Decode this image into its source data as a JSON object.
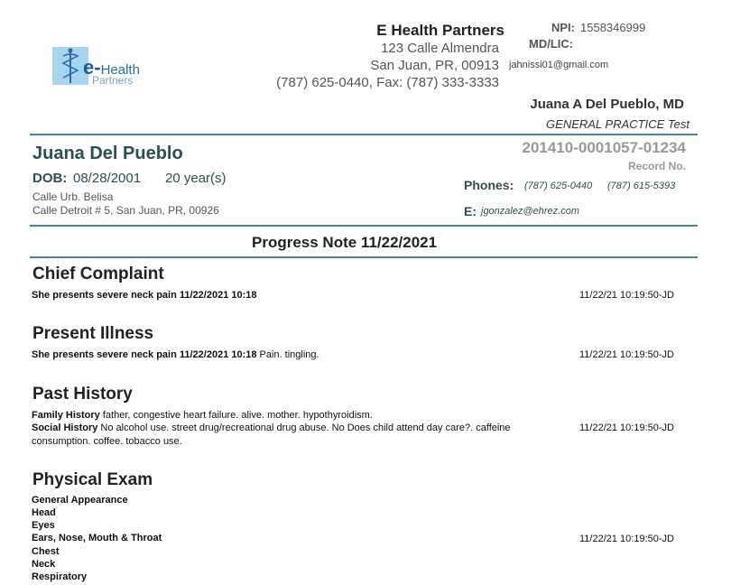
{
  "practice": {
    "logo_text_main": "e-",
    "logo_text_health": "Health",
    "logo_text_partners": "Partners",
    "name": "E Health Partners",
    "address1": "123 Calle Almendra",
    "address2": "San Juan, PR, 00913",
    "phone_fax": "(787) 625-0440, Fax: (787) 333-3333",
    "npi_label": "NPI:",
    "npi_value": "1558346999",
    "mdlic_label": "MD/LIC:",
    "email": "jahnissi01@gmail.com",
    "doctor_name": "Juana A Del Pueblo, MD",
    "doctor_specialty": "GENERAL PRACTICE Test"
  },
  "patient": {
    "name": "Juana Del Pueblo",
    "dob_label": "DOB:",
    "dob": "08/28/2001",
    "age": "20 year(s)",
    "address1": "Calle Urb. Belisa",
    "address2": "Calle Detroit # 5, San Juan, PR, 00926",
    "record_number": "201410-0001057-01234",
    "record_label": "Record No.",
    "phones_label": "Phones:",
    "phone1": "(787) 625-0440",
    "phone2": "(787) 615-5393",
    "email_label": "E:",
    "email": "jgonzalez@ehrez.com"
  },
  "note": {
    "title": "Progress Note  11/22/2021"
  },
  "sections": {
    "chief_complaint": {
      "title": "Chief Complaint",
      "text_bold": "She presents severe neck pain 11/22/2021 10:18",
      "stamp": "11/22/21 10:19:50-JD"
    },
    "present_illness": {
      "title": "Present Illness",
      "text_bold": "She presents severe neck pain 11/22/2021 10:18",
      "text": " Pain. tingling.",
      "stamp": "11/22/21 10:19:50-JD"
    },
    "past_history": {
      "title": "Past History",
      "family_label": "Family History",
      "family_text": " father, congestive heart failure. alive. mother. hypothyroidism.",
      "social_label": "Social History",
      "social_text": " No alcohol use. street drug/recreational drug abuse. No Does child attend day care?. caffeine",
      "social_text2": "consumption. coffee. tobacco use.",
      "stamp": "11/22/21 10:19:50-JD"
    },
    "physical_exam": {
      "title": "Physical Exam",
      "items": [
        "General Appearance",
        "Head",
        "Eyes",
        "Ears, Nose, Mouth & Throat",
        "Chest",
        "Neck",
        "Respiratory"
      ],
      "stamp": "11/22/21 10:19:50-JD"
    }
  },
  "colors": {
    "rule": "#4a7db1",
    "patient_text": "#2f4f4f",
    "logo_box": "#a7d4ee"
  }
}
